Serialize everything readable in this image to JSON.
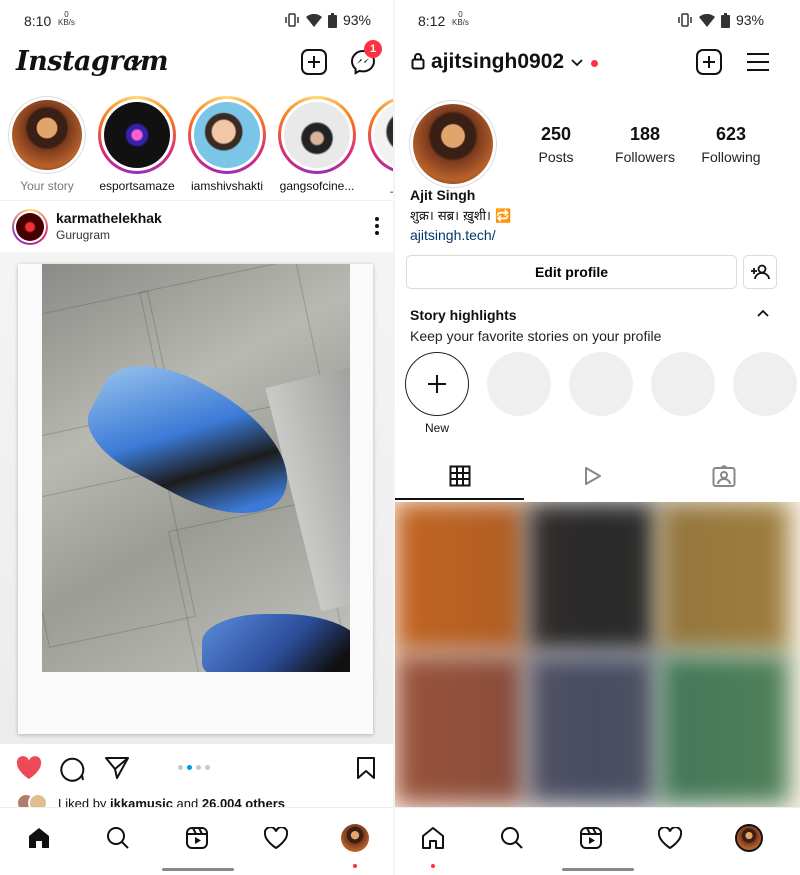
{
  "left": {
    "status": {
      "time": "8:10",
      "kbs_top": "0",
      "kbs_unit": "KB/s",
      "battery": "93%"
    },
    "header": {
      "logo": "Instagram",
      "messenger_badge": "1"
    },
    "stories": [
      {
        "name": "Your story"
      },
      {
        "name": "esportsamaze"
      },
      {
        "name": "iamshivshakti"
      },
      {
        "name": "gangsofcine..."
      },
      {
        "name": "_teafo"
      }
    ],
    "post": {
      "username": "karmathelekhak",
      "location": "Gurugram",
      "carousel_dots": 4,
      "carousel_active_index": 1
    },
    "likes": {
      "prefix": "Liked by ",
      "user": "ikkamusic",
      "middle": " and ",
      "others": "26,004 others"
    }
  },
  "right": {
    "status": {
      "time": "8:12",
      "kbs_top": "0",
      "kbs_unit": "KB/s",
      "battery": "93%"
    },
    "header": {
      "username": "ajitsingh0902"
    },
    "stats": [
      {
        "value": "250",
        "label": "Posts"
      },
      {
        "value": "188",
        "label": "Followers"
      },
      {
        "value": "623",
        "label": "Following"
      }
    ],
    "profile": {
      "name": "Ajit Singh",
      "bio": "शुक्र। सब्र। ख़ुशी। 🔁",
      "link": "ajitsingh.tech/"
    },
    "edit_profile_label": "Edit profile",
    "highlights": {
      "title": "Story highlights",
      "subtitle": "Keep your favorite stories on your profile",
      "new_label": "New"
    }
  },
  "colors": {
    "like_red": "#ed4956",
    "badge_red": "#ff3040",
    "link_blue": "#00376b",
    "dot_active": "#0095f6"
  }
}
